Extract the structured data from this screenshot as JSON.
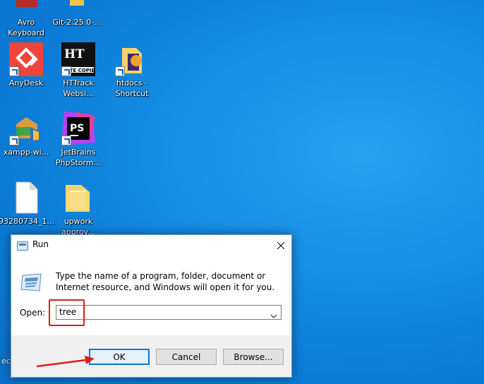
{
  "desktop": {
    "icons": [
      {
        "label": "Avro\nKeyboard",
        "icon": "avro-keyboard-icon"
      },
      {
        "label": "Git-2.25.0-...",
        "icon": "git-installer-icon"
      },
      {
        "label": "AnyDesk",
        "icon": "anydesk-icon"
      },
      {
        "label": "HTTrack\nWebsi...",
        "icon": "httrack-icon"
      },
      {
        "label": "htdocs -\nShortcut",
        "icon": "folder-shortcut-icon"
      },
      {
        "label": "xampp-wi...",
        "icon": "xampp-installer-icon"
      },
      {
        "label": "JetBrains\nPhpStorm...",
        "icon": "phpstorm-icon"
      },
      {
        "label": "93280734_1...",
        "icon": "file-icon"
      },
      {
        "label": "upwork\napprov...",
        "icon": "folder-icon"
      }
    ],
    "edge_label": "ec"
  },
  "httrack_text": "SITE COPIER",
  "phpstorm_text": "PS",
  "run_dialog": {
    "title": "Run",
    "description": "Type the name of a program, folder, document or Internet resource, and Windows will open it for you.",
    "open_label": "Open:",
    "open_value": "tree",
    "buttons": {
      "ok": "OK",
      "cancel": "Cancel",
      "browse": "Browse..."
    }
  },
  "colors": {
    "accent": "#0078d7",
    "annotation": "#e01b1b",
    "desktop": "#1690e6"
  }
}
